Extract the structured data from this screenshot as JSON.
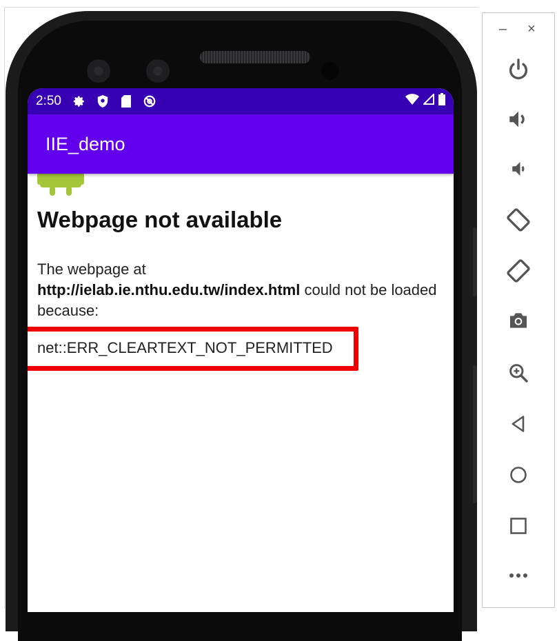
{
  "status_bar": {
    "time": "2:50",
    "left_icons": [
      "gear-icon",
      "shield-icon",
      "sd-card-icon",
      "at-sign-icon"
    ],
    "right_icons": [
      "wifi-icon",
      "signal-icon",
      "battery-icon"
    ]
  },
  "app": {
    "title": "IIE_demo"
  },
  "error_page": {
    "heading": "Webpage not available",
    "text_before": "The webpage at",
    "url": "http://ielab.ie.nthu.edu.tw/index.html",
    "text_after": "could not be loaded because:",
    "error_code": "net::ERR_CLEARTEXT_NOT_PERMITTED"
  },
  "emulator": {
    "window_controls": {
      "minimize": "–",
      "close": "×"
    },
    "tools": [
      "power-icon",
      "volume-up-icon",
      "volume-down-icon",
      "rotate-left-icon",
      "rotate-right-icon",
      "camera-icon",
      "zoom-icon",
      "back-icon",
      "home-icon",
      "overview-icon",
      "more-icon"
    ]
  },
  "colors": {
    "status_bar": "#3700b3",
    "app_bar": "#6200ee",
    "highlight": "#ee0000",
    "android_green": "#a4c639"
  }
}
